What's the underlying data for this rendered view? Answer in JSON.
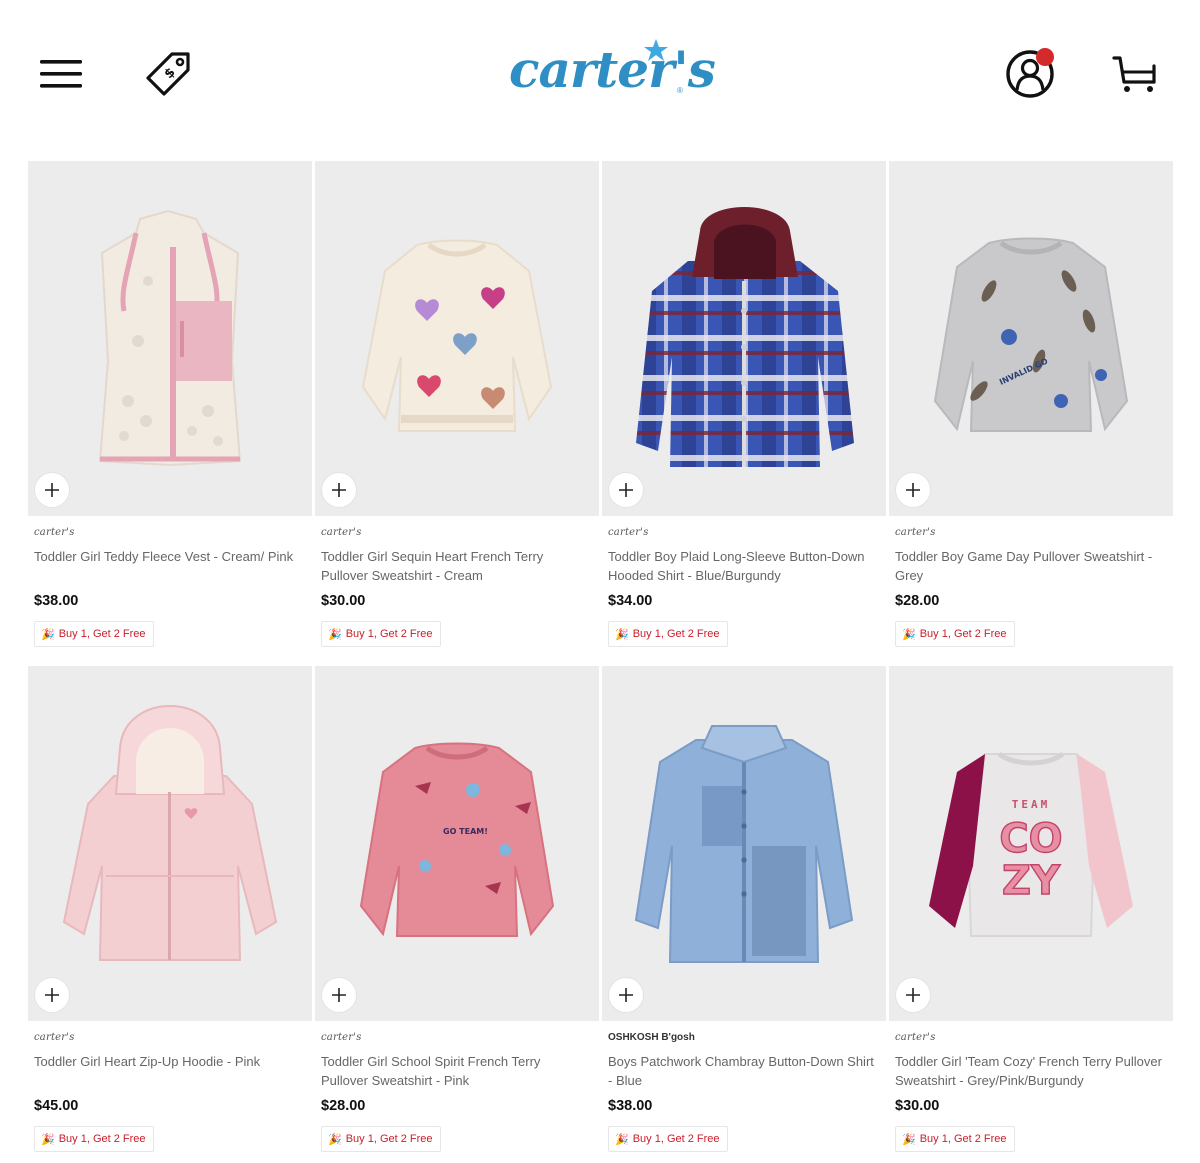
{
  "header": {
    "logo_text": "carter's",
    "logo_reg": "®",
    "icons": [
      "menu-icon",
      "price-tag-icon",
      "account-icon",
      "cart-icon"
    ],
    "brand_color": "#2f8fc4",
    "badge_color": "#d42a2a"
  },
  "products": [
    {
      "brand": "carter's",
      "title": "Toddler Girl Teddy Fleece Vest - Cream/ Pink",
      "price": "$38.00",
      "promo": "Buy 1, Get 2 Free"
    },
    {
      "brand": "carter's",
      "title": "Toddler Girl Sequin Heart French Terry Pullover Sweatshirt - Cream",
      "price": "$30.00",
      "promo": "Buy 1, Get 2 Free"
    },
    {
      "brand": "carter's",
      "title": "Toddler Boy Plaid Long-Sleeve Button-Down Hooded Shirt - Blue/Burgundy",
      "price": "$34.00",
      "promo": "Buy 1, Get 2 Free"
    },
    {
      "brand": "carter's",
      "title": "Toddler Boy Game Day Pullover Sweatshirt - Grey",
      "price": "$28.00",
      "promo": "Buy 1, Get 2 Free"
    },
    {
      "brand": "carter's",
      "title": "Toddler Girl Heart Zip-Up Hoodie - Pink",
      "price": "$45.00",
      "promo": "Buy 1, Get 2 Free"
    },
    {
      "brand": "carter's",
      "title": "Toddler Girl School Spirit French Terry Pullover Sweatshirt - Pink",
      "price": "$28.00",
      "promo": "Buy 1, Get 2 Free"
    },
    {
      "brand": "OSHKOSH B'gosh",
      "title": "Boys Patchwork Chambray Button-Down Shirt - Blue",
      "price": "$38.00",
      "promo": "Buy 1, Get 2 Free"
    },
    {
      "brand": "carter's",
      "title": "Toddler Girl 'Team Cozy' French Terry Pullover Sweatshirt - Grey/Pink/Burgundy",
      "price": "$30.00",
      "promo": "Buy 1, Get 2 Free"
    }
  ],
  "graphics": {
    "team_cozy_print": [
      "TEAM",
      "CO",
      "ZY"
    ],
    "spirit_print": "GO TEAM!",
    "game_day_print": "INVALID GO"
  },
  "promo_color": "#c8202c"
}
